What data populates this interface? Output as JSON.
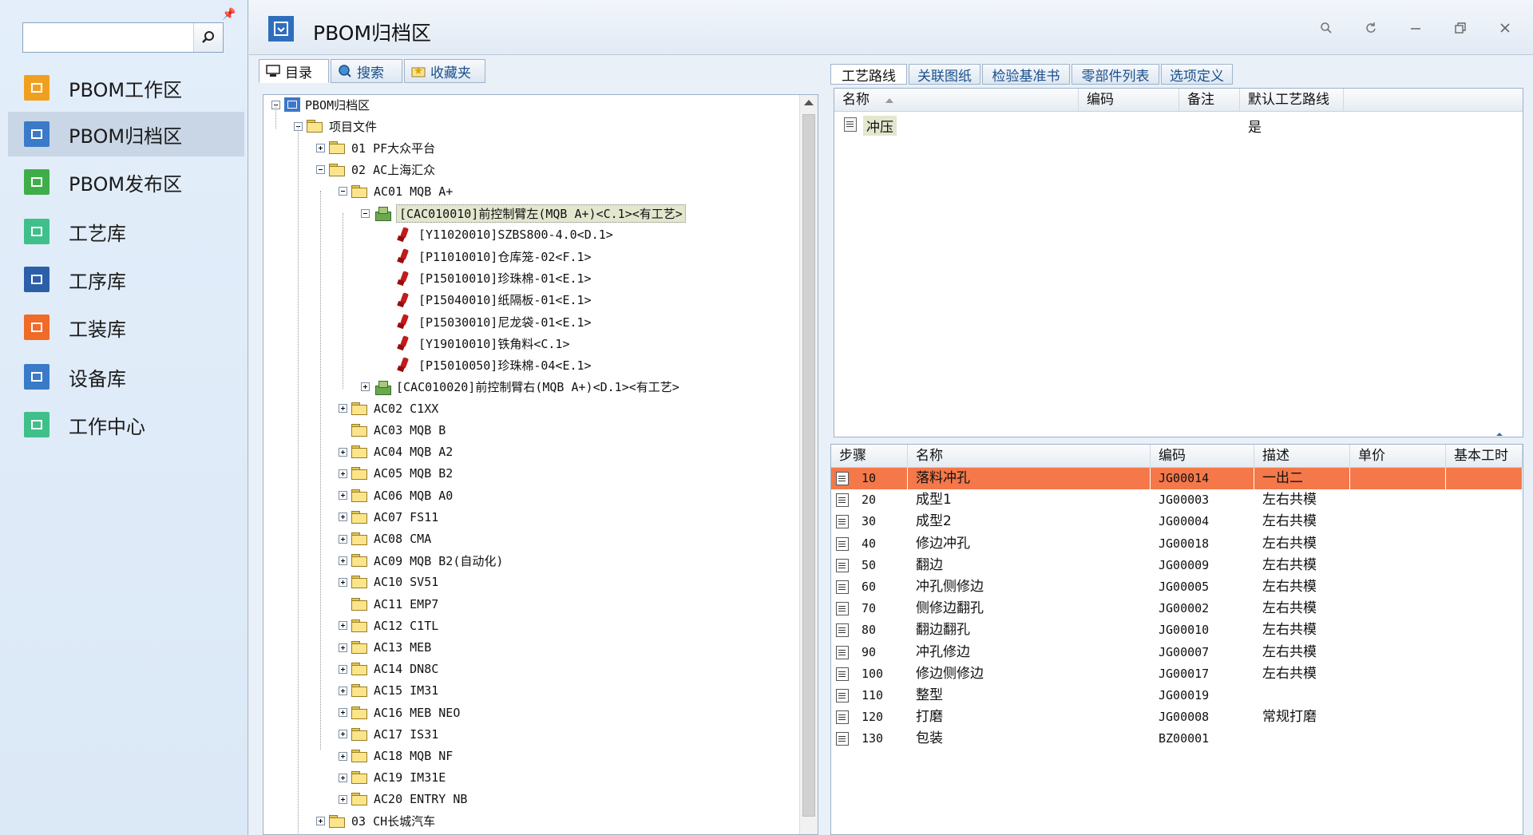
{
  "sidebar": {
    "search_placeholder": "",
    "items": [
      {
        "label": "PBOM工作区",
        "icon": "workspace-icon",
        "color": "#f0a020"
      },
      {
        "label": "PBOM归档区",
        "icon": "archive-icon",
        "color": "#3a7ac8",
        "active": true
      },
      {
        "label": "PBOM发布区",
        "icon": "publish-icon",
        "color": "#3fae4a"
      },
      {
        "label": "工艺库",
        "icon": "process-library-icon",
        "color": "#3fbf8a"
      },
      {
        "label": "工序库",
        "icon": "operation-library-icon",
        "color": "#2c5fa8"
      },
      {
        "label": "工装库",
        "icon": "tooling-library-icon",
        "color": "#f06a28"
      },
      {
        "label": "设备库",
        "icon": "equipment-library-icon",
        "color": "#3a7ac8"
      },
      {
        "label": "工作中心",
        "icon": "work-center-icon",
        "color": "#3fbf8a"
      }
    ]
  },
  "window": {
    "title": "PBOM归档区"
  },
  "left_tabs": [
    {
      "label": "目录",
      "active": true
    },
    {
      "label": "搜索"
    },
    {
      "label": "收藏夹"
    }
  ],
  "tree": {
    "root": "PBOM归档区",
    "project_folder": "项目文件",
    "platform_01": "01 PF大众平台",
    "platform_02": "02 AC上海汇众",
    "ac01": "AC01 MQB A+",
    "assembly_left": "[CAC010010]前控制臂左(MQB A+)<C.1><有工艺>",
    "parts": [
      "[Y11020010]SZBS800-4.0<D.1>",
      "[P11010010]仓库笼-02<F.1>",
      "[P15010010]珍珠棉-01<E.1>",
      "[P15040010]纸隔板-01<E.1>",
      "[P15030010]尼龙袋-01<E.1>",
      "[Y19010010]铁角料<C.1>",
      "[P15010050]珍珠棉-04<E.1>"
    ],
    "assembly_right": "[CAC010020]前控制臂右(MQB A+)<D.1><有工艺>",
    "ac_folders": [
      {
        "label": "AC02 C1XX",
        "expandable": true
      },
      {
        "label": "AC03 MQB B",
        "expandable": false
      },
      {
        "label": "AC04 MQB A2",
        "expandable": true
      },
      {
        "label": "AC05 MQB B2",
        "expandable": true
      },
      {
        "label": "AC06 MQB A0",
        "expandable": true
      },
      {
        "label": "AC07 FS11",
        "expandable": true
      },
      {
        "label": "AC08 CMA",
        "expandable": true
      },
      {
        "label": "AC09 MQB B2(自动化)",
        "expandable": true
      },
      {
        "label": "AC10 SV51",
        "expandable": true
      },
      {
        "label": "AC11 EMP7",
        "expandable": false
      },
      {
        "label": "AC12 C1TL",
        "expandable": true
      },
      {
        "label": "AC13 MEB",
        "expandable": true
      },
      {
        "label": "AC14 DN8C",
        "expandable": true
      },
      {
        "label": "AC15 IM31",
        "expandable": true
      },
      {
        "label": "AC16 MEB NEO",
        "expandable": true
      },
      {
        "label": "AC17 IS31",
        "expandable": true
      },
      {
        "label": "AC18 MQB NF",
        "expandable": true
      },
      {
        "label": "AC19 IM31E",
        "expandable": true
      },
      {
        "label": "AC20 ENTRY NB",
        "expandable": true
      }
    ],
    "platform_03": "03 CH长城汽车"
  },
  "right_tabs": [
    {
      "label": "工艺路线",
      "active": true
    },
    {
      "label": "关联图纸"
    },
    {
      "label": "检验基准书"
    },
    {
      "label": "零部件列表"
    },
    {
      "label": "选项定义"
    }
  ],
  "route_grid": {
    "columns": [
      "名称",
      "编码",
      "备注",
      "默认工艺路线"
    ],
    "rows": [
      {
        "name": "冲压",
        "code": "",
        "note": "",
        "default": "是"
      }
    ]
  },
  "steps_grid": {
    "columns": [
      "步骤",
      "名称",
      "编码",
      "描述",
      "单价",
      "基本工时"
    ],
    "rows": [
      {
        "step": "10",
        "name": "落料冲孔",
        "code": "JG00014",
        "desc": "一出二",
        "price": "",
        "hours": "",
        "selected": true
      },
      {
        "step": "20",
        "name": "成型1",
        "code": "JG00003",
        "desc": "左右共模",
        "price": "",
        "hours": ""
      },
      {
        "step": "30",
        "name": "成型2",
        "code": "JG00004",
        "desc": "左右共模",
        "price": "",
        "hours": ""
      },
      {
        "step": "40",
        "name": "修边冲孔",
        "code": "JG00018",
        "desc": "左右共模",
        "price": "",
        "hours": ""
      },
      {
        "step": "50",
        "name": "翻边",
        "code": "JG00009",
        "desc": "左右共模",
        "price": "",
        "hours": ""
      },
      {
        "step": "60",
        "name": "冲孔侧修边",
        "code": "JG00005",
        "desc": "左右共模",
        "price": "",
        "hours": ""
      },
      {
        "step": "70",
        "name": "侧修边翻孔",
        "code": "JG00002",
        "desc": "左右共模",
        "price": "",
        "hours": ""
      },
      {
        "step": "80",
        "name": "翻边翻孔",
        "code": "JG00010",
        "desc": "左右共模",
        "price": "",
        "hours": ""
      },
      {
        "step": "90",
        "name": "冲孔修边",
        "code": "JG00007",
        "desc": "左右共模",
        "price": "",
        "hours": ""
      },
      {
        "step": "100",
        "name": "修边侧修边",
        "code": "JG00017",
        "desc": "左右共模",
        "price": "",
        "hours": ""
      },
      {
        "step": "110",
        "name": "整型",
        "code": "JG00019",
        "desc": "",
        "price": "",
        "hours": ""
      },
      {
        "step": "120",
        "name": "打磨",
        "code": "JG00008",
        "desc": "常规打磨",
        "price": "",
        "hours": ""
      },
      {
        "step": "130",
        "name": "包装",
        "code": "BZ00001",
        "desc": "",
        "price": "",
        "hours": ""
      }
    ]
  },
  "colors": {
    "selected_row": "#f4784a",
    "accent_blue": "#2f6ebd"
  }
}
